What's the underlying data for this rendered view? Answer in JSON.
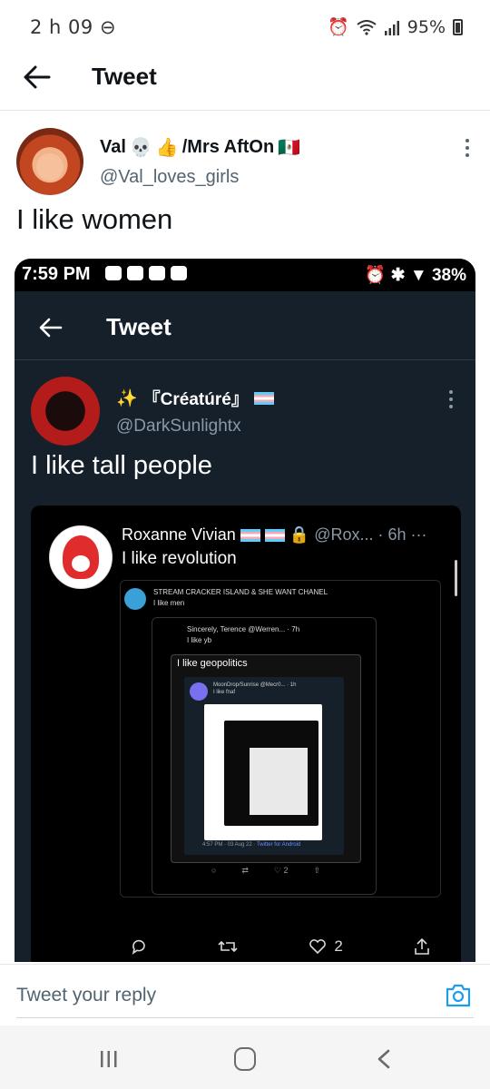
{
  "status_bar": {
    "time": "2 h 09",
    "battery": "95%"
  },
  "header": {
    "title": "Tweet"
  },
  "tweet": {
    "author_name": "Val",
    "author_name_suffix": "/Mrs AftOn",
    "handle": "@Val_loves_girls",
    "text": "I like women"
  },
  "screenshot": {
    "status_time": "7:59 PM",
    "status_battery": "38%",
    "header_title": "Tweet",
    "author_name": "『Créatúré』",
    "handle": "@DarkSunlightx",
    "text": "I like tall people",
    "quoted": {
      "name": "Roxanne Vivian",
      "handle_time": "@Rox... · 6h",
      "text": "I like revolution",
      "level3_name": "STREAM CRACKER ISLAND & SHE WANT CHANEL",
      "level3_text": "I like men",
      "level4_name": "Sincerely, Terence @Werren... · 7h",
      "level4_text": "I like yb",
      "level5_text": "I like geopolitics",
      "level6_name": "MoonDrop/Sunrise @Mecr0... · 1h",
      "level6_text": "I like fnaf",
      "level6_meta_time": "4:57 PM · 03 Aug 22 ·",
      "level6_meta_app": "Twitter for Android",
      "level6_likes": "2",
      "level4_likes": "1",
      "likes": "2"
    }
  },
  "reply_bar": {
    "placeholder": "Tweet your reply"
  },
  "icons": {
    "accent": "#1d9bf0"
  }
}
